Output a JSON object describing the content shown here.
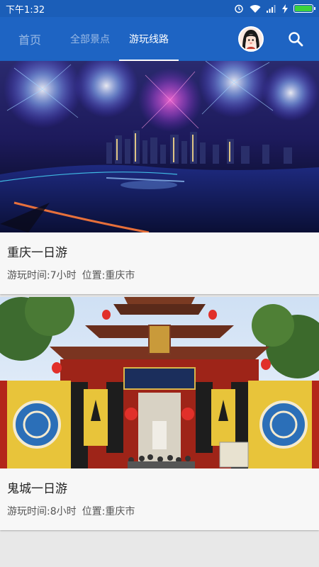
{
  "status_bar": {
    "time": "下午1:32",
    "icons": [
      "alarm-icon",
      "wifi-icon",
      "signal-icon",
      "charging-icon",
      "battery-icon"
    ],
    "battery_color": "#3cd23c"
  },
  "app_bar": {
    "background": "#1e64c3",
    "tabs": [
      {
        "label": "首页",
        "active": false
      },
      {
        "label": "全部景点",
        "active": false
      },
      {
        "label": "游玩线路",
        "active": true
      }
    ],
    "avatar": "avatar-icon",
    "search_icon": "search-icon"
  },
  "routes": [
    {
      "image": "chongqing-night-fireworks-photo",
      "title": "重庆一日游",
      "duration": "游玩时间:7小时",
      "location": "位置:重庆市"
    },
    {
      "image": "fengdu-ghost-city-gate-photo",
      "title": "鬼城一日游",
      "duration": "游玩时间:8小时",
      "location": "位置:重庆市"
    }
  ]
}
